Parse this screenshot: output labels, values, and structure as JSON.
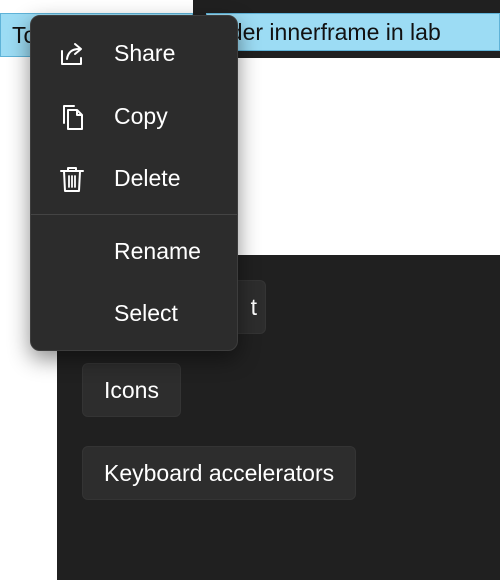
{
  "labels": {
    "left_text": "To",
    "right_text": "nder innerframe in lab"
  },
  "buttons": {
    "text_partial": "t",
    "icons": "Icons",
    "keyboard_accelerators": "Keyboard accelerators"
  },
  "flyout": {
    "items": [
      {
        "label": "Share",
        "icon": "share-icon"
      },
      {
        "label": "Copy",
        "icon": "copy-icon"
      },
      {
        "label": "Delete",
        "icon": "delete-icon"
      },
      {
        "label": "Rename",
        "icon": ""
      },
      {
        "label": "Select",
        "icon": ""
      }
    ]
  },
  "colors": {
    "label_background": "#9cdcf4",
    "panel_background": "#202020",
    "flyout_background": "#2c2c2c",
    "button_background": "#2d2d2d",
    "text_on_dark": "#ffffff"
  }
}
